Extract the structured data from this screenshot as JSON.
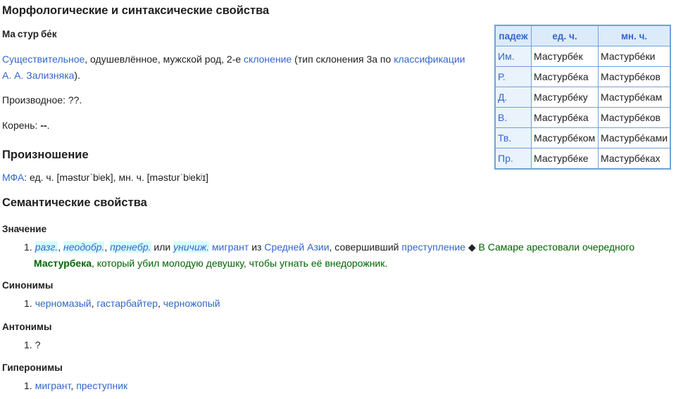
{
  "morph": {
    "heading": "Морфологические и синтаксические свойства",
    "word_parts": [
      "Ма",
      "стур",
      "бе́к"
    ],
    "pos_link": "Существительное",
    "pos_text1": ", одушевлённое, мужской род, 2-е ",
    "decl_link": "склонение",
    "pos_text2": " (тип склонения 3a по ",
    "class_link": "классификации",
    "zal_link": "А. А. Зализняка",
    "pos_text3": ").",
    "derived": "Производное: ??.",
    "root_label": "Корень: ",
    "root_value": "--",
    "root_end": "."
  },
  "table": {
    "headers": {
      "case": "падеж",
      "sg": "ед. ч.",
      "pl": "мн. ч."
    },
    "rows": [
      {
        "case": "Им.",
        "sg": "Мастурбе́к",
        "pl": "Мастурбе́ки"
      },
      {
        "case": "Р.",
        "sg": "Мастурбе́ка",
        "pl": "Мастурбе́ков"
      },
      {
        "case": "Д.",
        "sg": "Мастурбе́ку",
        "pl": "Мастурбе́кам"
      },
      {
        "case": "В.",
        "sg": "Мастурбе́ка",
        "pl": "Мастурбе́ков"
      },
      {
        "case": "Тв.",
        "sg": "Мастурбе́ком",
        "pl": "Мастурбе́ками"
      },
      {
        "case": "Пр.",
        "sg": "Мастурбе́ке",
        "pl": "Мастурбе́ках"
      }
    ]
  },
  "pron": {
    "heading": "Произношение",
    "ipa_link": "МФА",
    "text": ": ед. ч. [məstʊrˈbʲek], мн. ч. [məstʊrˈbʲekʲɪ]"
  },
  "semantic": {
    "heading": "Семантические свойства",
    "meaning": {
      "heading": "Значение",
      "num": "1.",
      "abbr1": "разг.",
      "sep1": ", ",
      "abbr2": "неодобр.",
      "sep2": ", ",
      "abbr3": "пренебр.",
      "or": " или ",
      "abbr4": "уничиж.",
      "link_migrant": "мигрант",
      "text_from": " из ",
      "link_asia": "Средней Азии",
      "text_comm": ", совершивший ",
      "link_crime": "преступление",
      "diamond": " ◆ ",
      "ex1": "В Самаре арестовали очередного",
      "ex_bold": "Мастурбека",
      "ex2": ", который убил молодую девушку, чтобы угнать её внедорожник."
    },
    "synonyms": {
      "heading": "Синонимы",
      "num": "1.",
      "items": [
        "черномазый",
        "гастарбайтер",
        "черножопый"
      ],
      "sep": ", "
    },
    "antonyms": {
      "heading": "Антонимы",
      "num": "1.",
      "value": "?"
    },
    "hyperonyms": {
      "heading": "Гиперонимы",
      "num": "1.",
      "items": [
        "мигрант",
        "преступник"
      ],
      "sep": ", "
    }
  }
}
